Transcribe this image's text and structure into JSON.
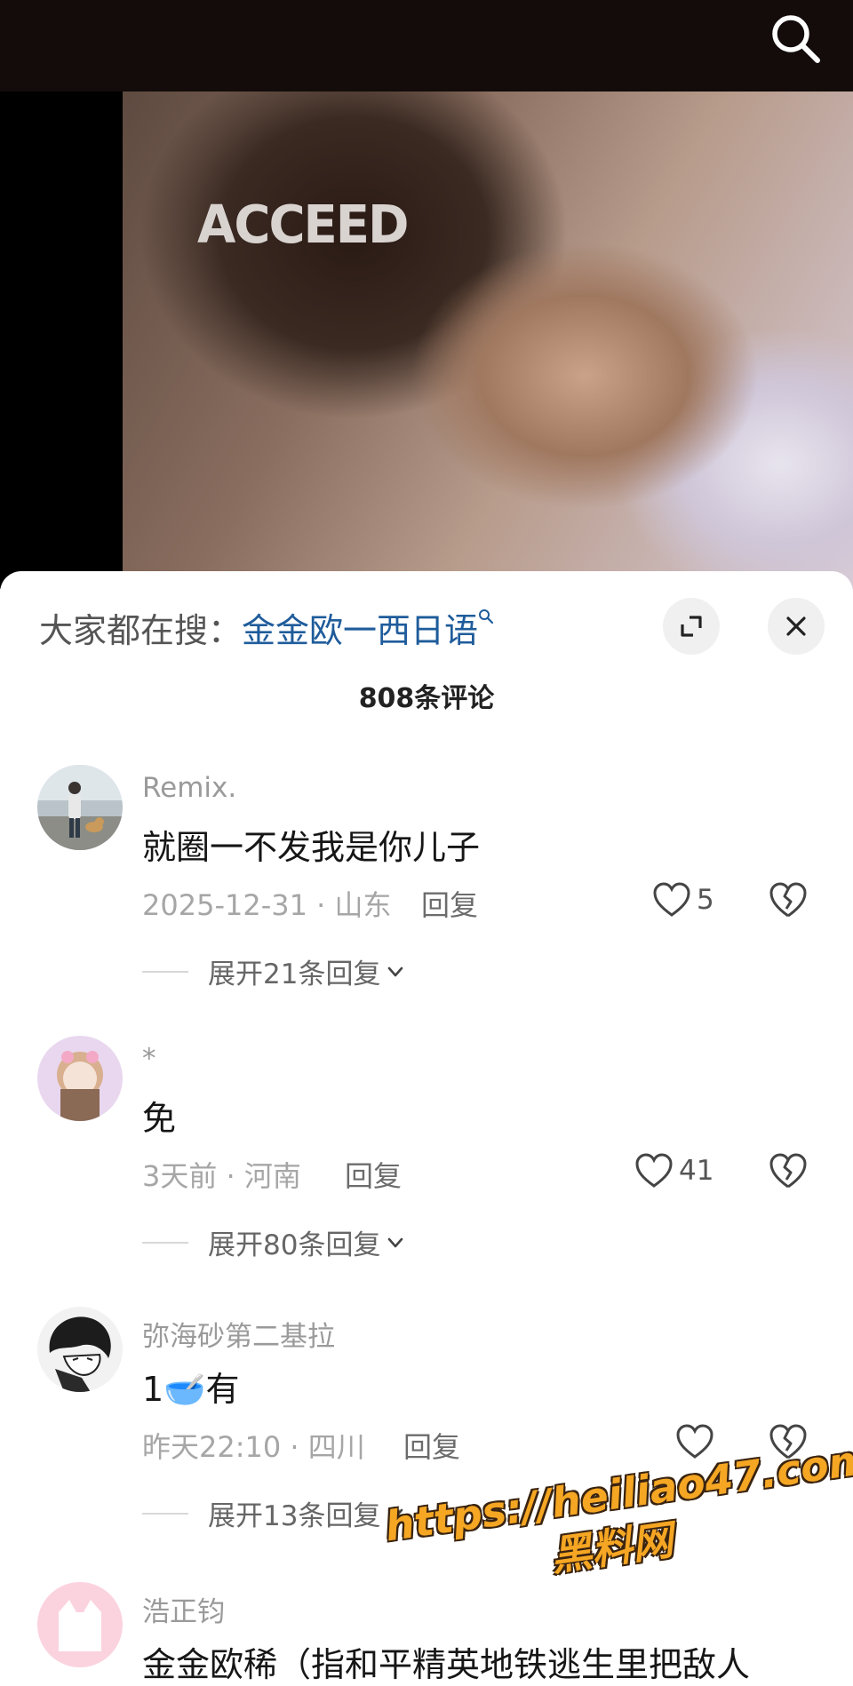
{
  "video": {
    "logo_text": "ACCEED"
  },
  "sheet": {
    "search_prefix": "大家都在搜：",
    "search_keyword": "金金欧一西日语",
    "comment_count": "808条评论"
  },
  "comments": [
    {
      "username": "Remix.",
      "content": "就圈一不发我是你儿子",
      "meta": "2025-12-31 · 山东",
      "reply": "回复",
      "likes": "5",
      "expand": "展开21条回复"
    },
    {
      "username": "*",
      "content": "免",
      "meta": "3天前 · 河南",
      "reply": "回复",
      "likes": "41",
      "expand": "展开80条回复"
    },
    {
      "username": "弥海砂第二基拉",
      "content": "1🥣有",
      "meta": "昨天22:10 · 四川",
      "reply": "回复",
      "likes": "",
      "expand": "展开13条回复"
    },
    {
      "username": "浩正钧",
      "content": "金金欧稀（指和平精英地铁逃生里把敌人",
      "meta": "",
      "reply": "",
      "likes": "",
      "expand": ""
    }
  ],
  "watermark": {
    "url": "https://heiliao47.com",
    "name": "黑料网"
  },
  "colors": {
    "keyword": "#1f5c9b",
    "topbar": "#130c0b",
    "watermark": "#f5a623"
  }
}
